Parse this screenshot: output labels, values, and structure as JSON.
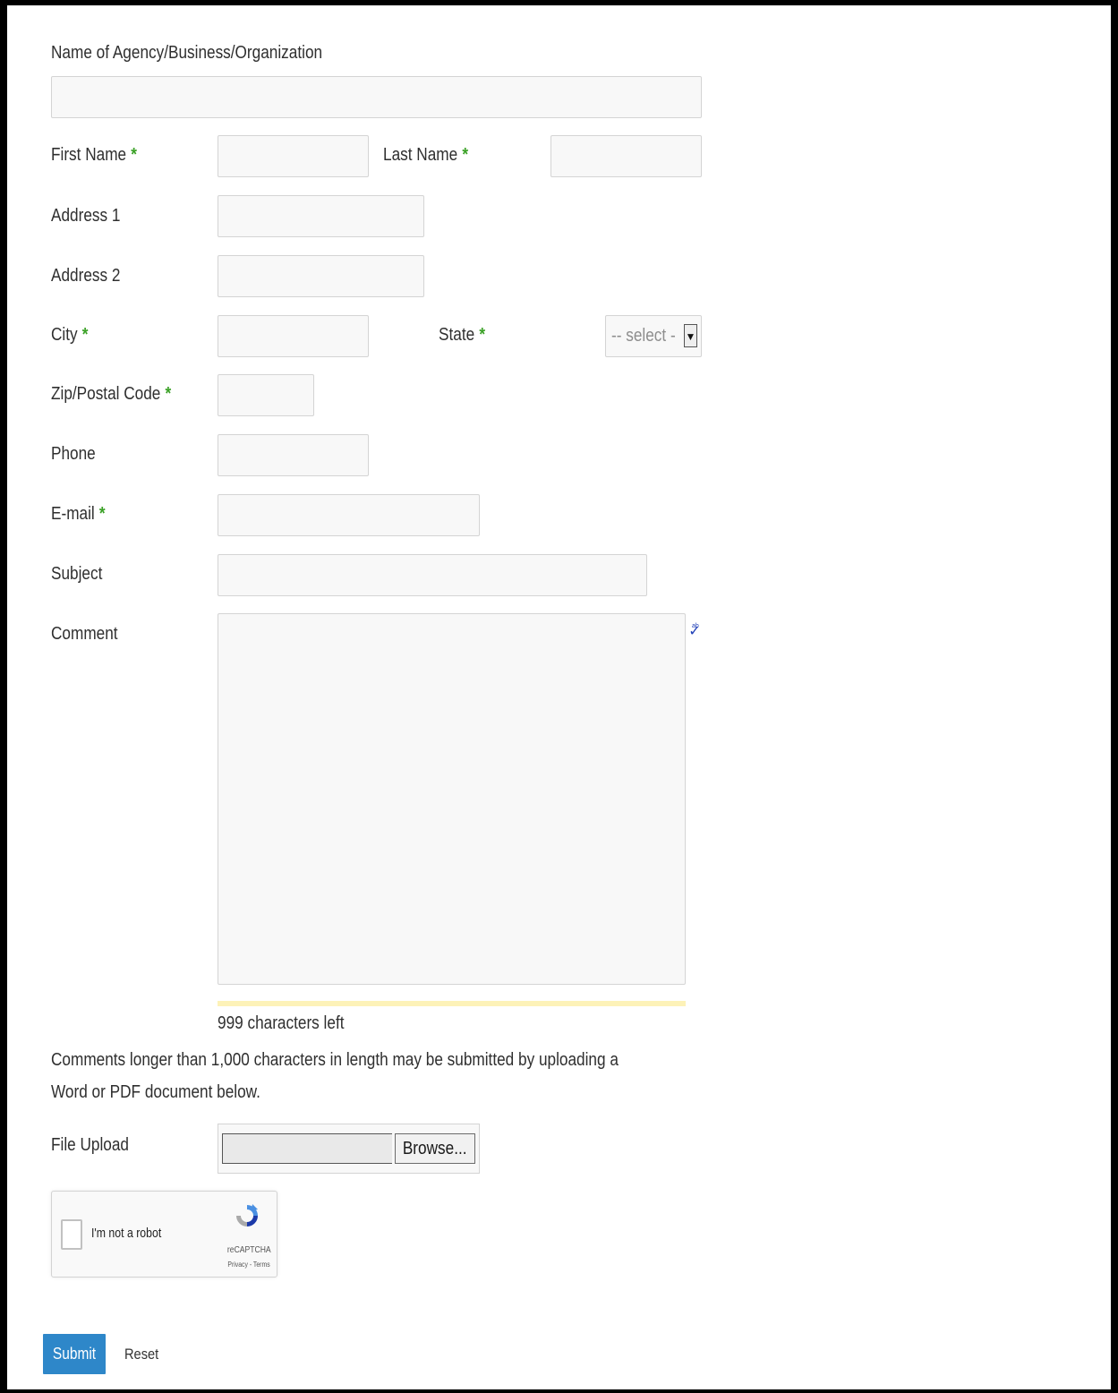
{
  "form": {
    "org_label": "Name of Agency/Business/Organization",
    "first_name_label": "First Name",
    "last_name_label": "Last Name",
    "address1_label": "Address 1",
    "address2_label": "Address 2",
    "city_label": "City",
    "state_label": "State",
    "state_select_value": "-- select -",
    "zip_label": "Zip/Postal Code",
    "phone_label": "Phone",
    "email_label": "E-mail",
    "subject_label": "Subject",
    "comment_label": "Comment",
    "required_marker": "*",
    "chars_left": "999 characters left",
    "comment_note": "Comments longer than 1,000 characters in length may be submitted by uploading a Word or PDF document below.",
    "file_upload_label": "File Upload",
    "browse_label": "Browse..."
  },
  "captcha": {
    "label": "I'm not a robot",
    "brand": "reCAPTCHA",
    "links": "Privacy - Terms"
  },
  "actions": {
    "submit_label": "Submit",
    "reset_label": "Reset"
  },
  "colors": {
    "required": "#3aa126",
    "submit_bg": "#2e87c9",
    "counter_bar": "#fdf2b8"
  }
}
